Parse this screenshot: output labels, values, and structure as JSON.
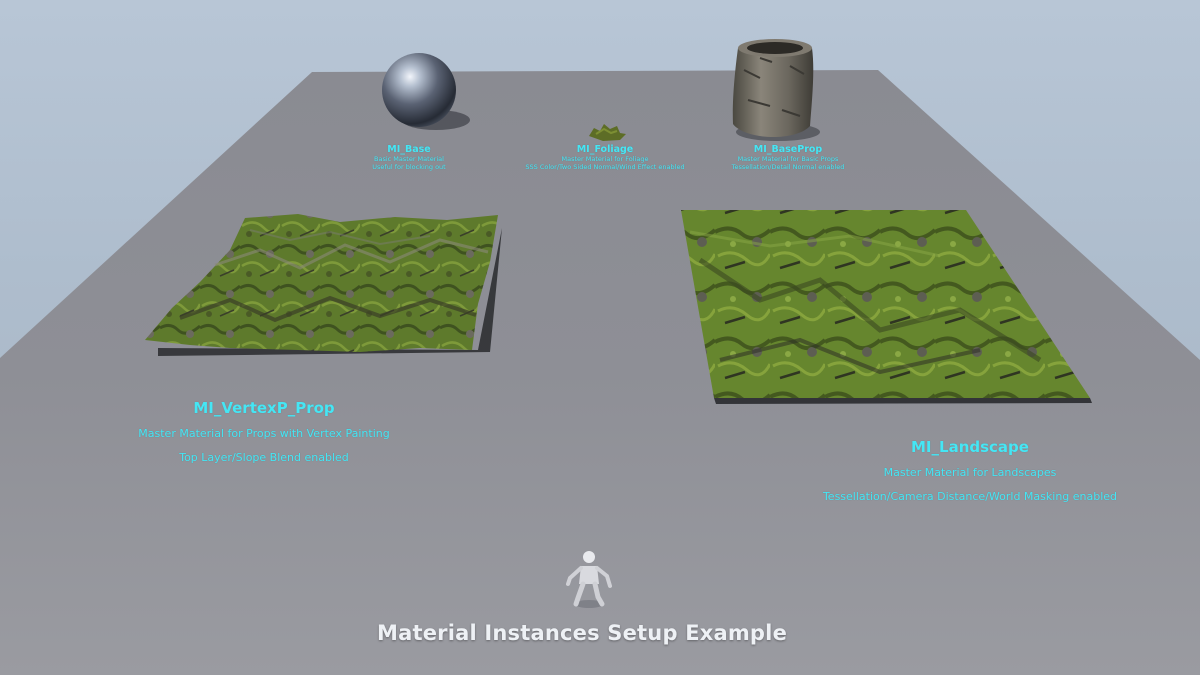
{
  "scene": {
    "title": "Material Instances Setup Example",
    "colors": {
      "sky": "#b3c1d2",
      "floor": "#8f9097",
      "label_text": "#45e6f4",
      "title_text": "#eef1f5",
      "moss": "#5c7a2a",
      "rock": "#6f6a60"
    }
  },
  "objects": {
    "base": {
      "name": "MI_Base",
      "desc_1": "Basic Master Material",
      "desc_2": "Useful for blocking out",
      "icon": "chrome-sphere-icon"
    },
    "foliage": {
      "name": "MI_Foliage",
      "desc_1": "Master Material for Foliage",
      "desc_2": "SSS Color/Two Sided Normal/Wind Effect enabled",
      "icon": "foliage-clump-icon"
    },
    "baseprop": {
      "name": "MI_BaseProp",
      "desc_1": "Master Material for Basic Props",
      "desc_2": "Tessellation/Detail Normal enabled",
      "icon": "rock-cylinder-icon"
    },
    "vertex_prop": {
      "name": "MI_VertexP_Prop",
      "desc_1": "Master Material for Props with Vertex Painting",
      "desc_2": "Top Layer/Slope Blend enabled",
      "icon": "mossy-terrain-patch-icon"
    },
    "landscape": {
      "name": "MI_Landscape",
      "desc_1": "Master Material for Landscapes",
      "desc_2": "Tessellation/Camera Distance/World Masking enabled",
      "icon": "mossy-landscape-plane-icon"
    }
  },
  "mannequin": {
    "icon": "mannequin-character-icon"
  }
}
